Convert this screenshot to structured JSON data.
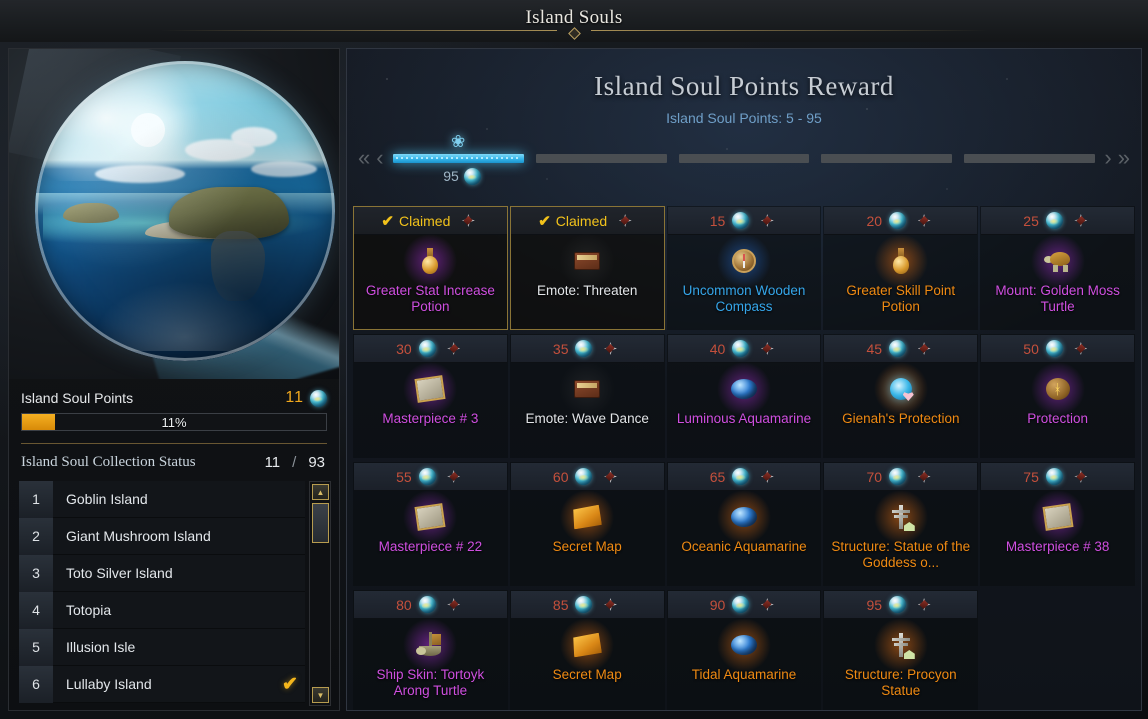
{
  "window": {
    "title": "Island Souls"
  },
  "left": {
    "globe_alt": "island-sphere-artwork",
    "points_label": "Island Soul Points",
    "points_value": "11",
    "points_orb_icon": "soul-orb-icon",
    "progress_text": "11%",
    "progress_percent": 11,
    "collection_title": "Island Soul Collection Status",
    "collection_current": "11",
    "collection_separator": "/",
    "collection_total": "93",
    "islands": [
      {
        "index": "1",
        "name": "Goblin Island",
        "claimed": false
      },
      {
        "index": "2",
        "name": "Giant Mushroom Island",
        "claimed": false
      },
      {
        "index": "3",
        "name": "Toto Silver Island",
        "claimed": false
      },
      {
        "index": "4",
        "name": "Totopia",
        "claimed": false
      },
      {
        "index": "5",
        "name": "Illusion Isle",
        "claimed": false
      },
      {
        "index": "6",
        "name": "Lullaby Island",
        "claimed": true
      }
    ],
    "check_glyph": "✔",
    "scroll_up_icon": "scroll-up-arrow-icon",
    "scroll_down_icon": "scroll-down-arrow-icon"
  },
  "right": {
    "title": "Island Soul Points Reward",
    "subtitle": "Island Soul Points: 5 - 95",
    "nav": {
      "first_icon": "«",
      "prev_icon": "‹",
      "next_icon": "›",
      "last_icon": "»",
      "current_segment_cost": "95",
      "marker_icon": "soul-marker-icon",
      "segments": [
        {
          "active": true
        },
        {
          "active": false
        },
        {
          "active": false
        },
        {
          "active": false
        },
        {
          "active": false
        }
      ]
    },
    "claimed_label": "Claimed",
    "rewards": [
      {
        "cost": "",
        "claimed": true,
        "name": "Greater Stat Increase Potion",
        "quality": "purple",
        "icon": "potion-icon",
        "aura": "purple"
      },
      {
        "cost": "",
        "claimed": true,
        "name": "Emote: Threaten",
        "quality": "white",
        "icon": "book-icon",
        "aura": "none"
      },
      {
        "cost": "15",
        "claimed": false,
        "name": "Uncommon Wooden Compass",
        "quality": "blue",
        "icon": "compass-icon",
        "aura": "blue"
      },
      {
        "cost": "20",
        "claimed": false,
        "name": "Greater Skill Point Potion",
        "quality": "orange",
        "icon": "potion-icon",
        "aura": "orange"
      },
      {
        "cost": "25",
        "claimed": false,
        "name": "Mount: Golden Moss Turtle",
        "quality": "purple",
        "icon": "turtle-icon",
        "aura": "purple"
      },
      {
        "cost": "30",
        "claimed": false,
        "name": "Masterpiece # 3",
        "quality": "purple",
        "icon": "map-icon",
        "aura": "purple"
      },
      {
        "cost": "35",
        "claimed": false,
        "name": "Emote: Wave Dance",
        "quality": "white",
        "icon": "book-icon",
        "aura": "none"
      },
      {
        "cost": "40",
        "claimed": false,
        "name": "Luminous Aquamarine",
        "quality": "purple",
        "icon": "gem-icon",
        "aura": "purple"
      },
      {
        "cost": "45",
        "claimed": false,
        "name": "Gienah's Protection",
        "quality": "orange",
        "icon": "heart-gem-icon",
        "aura": "orange"
      },
      {
        "cost": "50",
        "claimed": false,
        "name": "Protection",
        "quality": "purple",
        "icon": "rune-icon",
        "aura": "purple"
      },
      {
        "cost": "55",
        "claimed": false,
        "name": "Masterpiece # 22",
        "quality": "purple",
        "icon": "map-icon",
        "aura": "purple"
      },
      {
        "cost": "60",
        "claimed": false,
        "name": "Secret Map",
        "quality": "orange",
        "icon": "treasure-map-icon",
        "aura": "orange"
      },
      {
        "cost": "65",
        "claimed": false,
        "name": "Oceanic Aquamarine",
        "quality": "orange",
        "icon": "gem-icon",
        "aura": "orange"
      },
      {
        "cost": "70",
        "claimed": false,
        "name": "Structure: Statue of the Goddess o...",
        "quality": "orange",
        "icon": "statue-icon",
        "aura": "orange"
      },
      {
        "cost": "75",
        "claimed": false,
        "name": "Masterpiece # 38",
        "quality": "purple",
        "icon": "map-icon",
        "aura": "purple"
      },
      {
        "cost": "80",
        "claimed": false,
        "name": "Ship Skin: Tortoyk Arong Turtle",
        "quality": "purple",
        "icon": "ship-icon",
        "aura": "purple"
      },
      {
        "cost": "85",
        "claimed": false,
        "name": "Secret Map",
        "quality": "orange",
        "icon": "treasure-map-icon",
        "aura": "orange"
      },
      {
        "cost": "90",
        "claimed": false,
        "name": "Tidal Aquamarine",
        "quality": "orange",
        "icon": "gem-icon",
        "aura": "orange"
      },
      {
        "cost": "95",
        "claimed": false,
        "name": "Structure: Procyon Statue",
        "quality": "orange",
        "icon": "statue-icon",
        "aura": "orange"
      },
      {
        "cost": "",
        "claimed": false,
        "name": "",
        "quality": "white",
        "icon": "",
        "aura": "none",
        "empty": true
      }
    ],
    "badge_icon": "rarity-badge-icon",
    "cost_orb_icon": "soul-orb-icon"
  },
  "colors": {
    "accent_gold": "#f2c21b",
    "cost_red": "#c4503c",
    "quality_purple": "#cf4fe0",
    "quality_orange": "#ef8a13",
    "quality_blue": "#35a6ea",
    "progress_fill": "#f5b022",
    "segment_active": "#35b6ea"
  }
}
